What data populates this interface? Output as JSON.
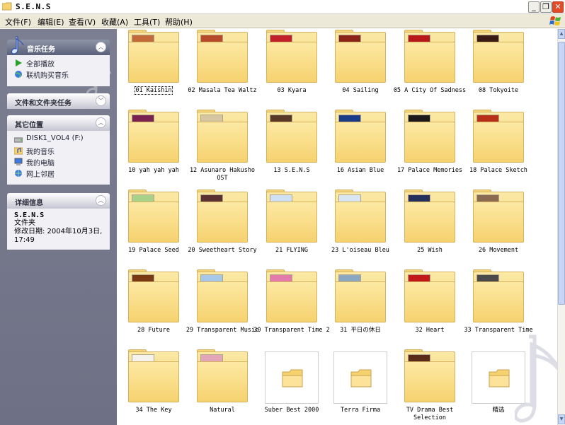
{
  "window": {
    "title": "S.E.N.S",
    "controls": [
      "minimize",
      "maximize",
      "close"
    ]
  },
  "menu": [
    {
      "label": "文件(F)"
    },
    {
      "label": "编辑(E)"
    },
    {
      "label": "查看(V)"
    },
    {
      "label": "收藏(A)"
    },
    {
      "label": "工具(T)"
    },
    {
      "label": "帮助(H)"
    }
  ],
  "sidebar": {
    "music_tasks": {
      "title": "音乐任务",
      "items": [
        {
          "label": "全部播放",
          "icon": "play-icon"
        },
        {
          "label": "联机购买音乐",
          "icon": "globe-icon"
        }
      ]
    },
    "file_tasks": {
      "title": "文件和文件夹任务"
    },
    "other_places": {
      "title": "其它位置",
      "items": [
        {
          "label": "DISK1_VOL4 (F:)",
          "icon": "drive-icon"
        },
        {
          "label": "我的音乐",
          "icon": "my-music-icon"
        },
        {
          "label": "我的电脑",
          "icon": "computer-icon"
        },
        {
          "label": "网上邻居",
          "icon": "network-icon"
        }
      ]
    },
    "details": {
      "title": "详细信息",
      "name": "S.E.N.S",
      "type": "文件夹",
      "modified_label": "修改日期: 2004年10月3日,",
      "modified_time": "17:49"
    }
  },
  "folders": [
    {
      "label": "01 Kaishin",
      "thumb": "#c26a3a",
      "selected": true
    },
    {
      "label": "02 Masala Tea Waltz",
      "thumb": "#b64a2a"
    },
    {
      "label": "03 Kyara",
      "thumb": "#c0202a"
    },
    {
      "label": "04 Sailing",
      "thumb": "#8a2418"
    },
    {
      "label": "05 A City Of Sadness",
      "thumb": "#b8181a"
    },
    {
      "label": "08 Tokyoite",
      "thumb": "#3a1a14"
    },
    {
      "label": "10 yah yah yah",
      "thumb": "#7a2250"
    },
    {
      "label": "12 Asunaro Hakusho OST",
      "thumb": "#d6c6a2"
    },
    {
      "label": "13 S.E.N.S",
      "thumb": "#5a3828"
    },
    {
      "label": "16 Asian Blue",
      "thumb": "#1a3a8a"
    },
    {
      "label": "17 Palace Memories",
      "thumb": "#1a1a1a"
    },
    {
      "label": "18 Palace Sketch",
      "thumb": "#b8301a"
    },
    {
      "label": "19 Palace Seed",
      "thumb": "#a8d28a"
    },
    {
      "label": "20 Sweetheart Story",
      "thumb": "#5a3030"
    },
    {
      "label": "21 FLYING",
      "thumb": "#cfe0f2"
    },
    {
      "label": "23 L'oiseau Bleu",
      "thumb": "#d8e6f4"
    },
    {
      "label": "25 Wish",
      "thumb": "#23305a"
    },
    {
      "label": "26 Movement",
      "thumb": "#8a6a50"
    },
    {
      "label": "28 Future",
      "thumb": "#7a3a14"
    },
    {
      "label": "29 Transparent Music",
      "thumb": "#a8c8e8"
    },
    {
      "label": "30 Transparent Time 2",
      "thumb": "#e27aaa"
    },
    {
      "label": "31 平日の休日",
      "thumb": "#8aa8c2"
    },
    {
      "label": "32 Heart",
      "thumb": "#c21a1a"
    },
    {
      "label": "33 Transparent Time",
      "thumb": "#4a4a4a"
    },
    {
      "label": "34 The Key",
      "thumb": "#f6f2ee"
    },
    {
      "label": "Natural",
      "thumb": "#e2a8ba"
    },
    {
      "label": "Suber Best 2000",
      "plain": true
    },
    {
      "label": "Terra Firma",
      "plain": true
    },
    {
      "label": "TV Drama Best Selection",
      "thumb": "#5a2a1a"
    },
    {
      "label": "精选",
      "plain": true
    }
  ]
}
